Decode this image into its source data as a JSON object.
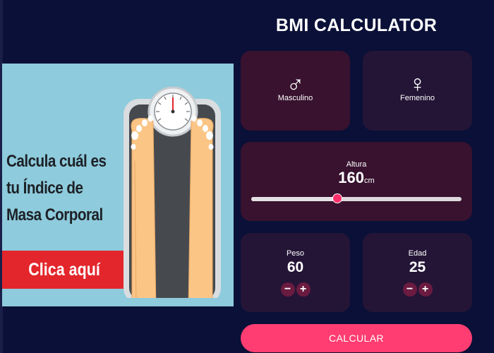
{
  "title": "BMI CALCULATOR",
  "promo": {
    "lines": [
      "Calcula cuál es",
      "tu Índice de",
      "Masa Corporal"
    ],
    "cta_label": "Clica aquí"
  },
  "gender": {
    "male": {
      "icon": "male-symbol-icon",
      "glyph": "♂",
      "label": "Masculino",
      "selected": true
    },
    "female": {
      "icon": "female-symbol-icon",
      "glyph": "♀",
      "label": "Femenino",
      "selected": false
    }
  },
  "height": {
    "label": "Altura",
    "value": "160",
    "unit": "cm",
    "slider_fraction": 0.41
  },
  "weight": {
    "label": "Peso",
    "value": "60",
    "minus": "−",
    "plus": "+"
  },
  "age": {
    "label": "Edad",
    "value": "25",
    "minus": "−",
    "plus": "+"
  },
  "calculate_label": "CALCULAR",
  "colors": {
    "background": "#0a1037",
    "card_active": "#38122f",
    "card_inactive": "#241537",
    "accent": "#ff3d72",
    "promo_bg": "#8ecbdc",
    "promo_cta": "#e3262c"
  }
}
